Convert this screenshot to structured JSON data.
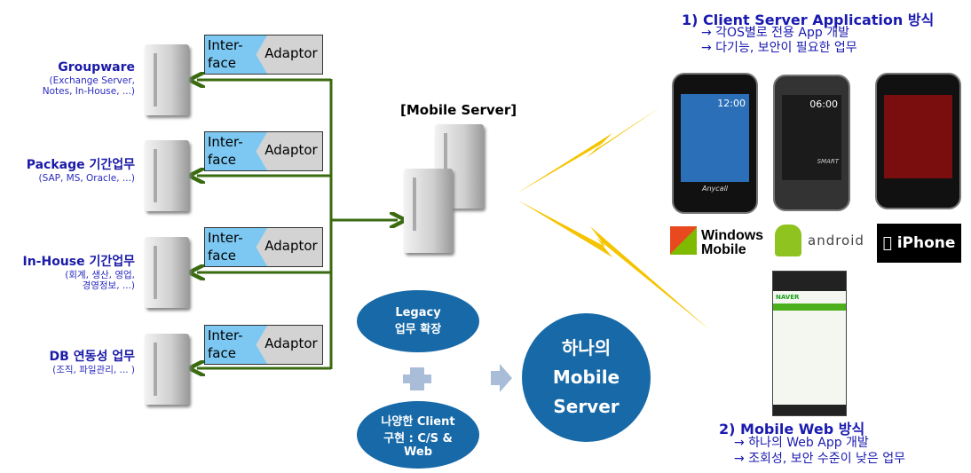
{
  "systems": [
    {
      "title": "Groupware",
      "sub": [
        "(Exchange Server,",
        "Notes, In-House, ...)"
      ]
    },
    {
      "title": "Package 기간업무",
      "sub": [
        "(SAP, MS, Oracle, ...)"
      ]
    },
    {
      "title": "In-House 기간업무",
      "sub": [
        "(회계, 생산, 영업,",
        "경영정보, ...)"
      ]
    },
    {
      "title": "DB 연동성 업무",
      "sub": [
        "(조직, 파일관리, ... )"
      ]
    }
  ],
  "adaptor": {
    "interface_line1": "Inter-",
    "interface_line2": "face",
    "adaptor": "Adaptor"
  },
  "mobile_server_label": "[Mobile Server]",
  "legacy": {
    "line1": "Legacy",
    "line2": "업무 확장"
  },
  "client": {
    "line1": "나양한 Client",
    "line2": "구현 : C/S &",
    "line3": "Web"
  },
  "hub": {
    "line1": "하나의",
    "line2": "Mobile",
    "line3": "Server"
  },
  "cs": {
    "title": "1) Client Server Application 방식",
    "points": [
      "→ 각OS별로 전용 App 개발",
      "→ 다기능, 보안이 필요한 업무"
    ]
  },
  "phones": {
    "p1_brand": "Anycall",
    "p1_time": "12:00",
    "p2_time": "06:00",
    "p2_brand": "SMART"
  },
  "logos": {
    "windows": [
      "Windows",
      "Mobile"
    ],
    "android": "android",
    "iphone": "iPhone"
  },
  "web": {
    "title": "2) Mobile Web 방식",
    "points": [
      "→ 하나의 Web App 개발",
      "→ 조회성, 보안 수준이 낮은 업무"
    ],
    "browser_brand": "NAVER"
  },
  "colors": {
    "line": "#3a6b10",
    "ellipse": "#1769a8",
    "interface": "#7cc8f2",
    "bolt": "#f5c400",
    "text": "#1a1ab0"
  }
}
